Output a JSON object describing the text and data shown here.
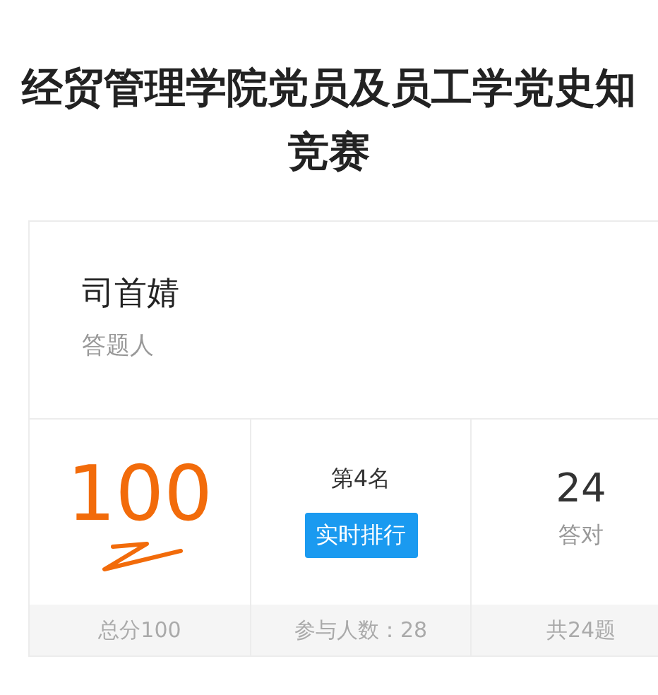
{
  "title": "经贸管理学院党员及员工学党史知竞赛",
  "respondent": {
    "name": "司首婧",
    "label": "答题人"
  },
  "stats": [
    {
      "kind": "score",
      "value": "100",
      "footer": "总分100"
    },
    {
      "kind": "rank",
      "rank": "第4名",
      "button": "实时排行",
      "footer": "参与人数：28"
    },
    {
      "kind": "count",
      "value": "24",
      "label": "答对",
      "footer": "共24题"
    }
  ]
}
